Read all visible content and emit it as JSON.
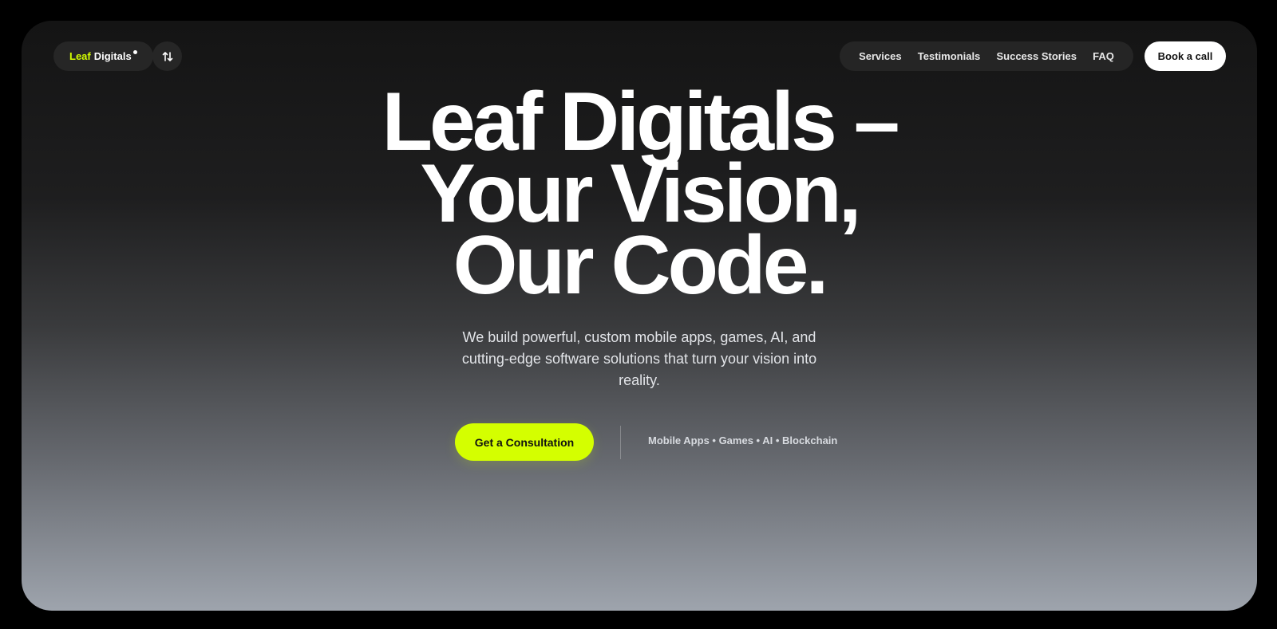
{
  "brand": {
    "leaf": "Leaf",
    "digitals": "Digitals"
  },
  "icons": {
    "swap": "swap-vertical-icon",
    "registered": "registered-dot-icon"
  },
  "nav": {
    "items": [
      {
        "label": "Services"
      },
      {
        "label": "Testimonials"
      },
      {
        "label": "Success Stories"
      },
      {
        "label": "FAQ"
      }
    ],
    "cta_label": "Book a call"
  },
  "hero": {
    "line1": "Leaf Digitals –",
    "line2": "Your Vision,",
    "line3": "Our Code.",
    "subtext": "We build powerful, custom mobile apps, games, AI, and cutting-edge software solutions that turn your vision into reality.",
    "cta_label": "Get a Consultation",
    "tags": "Mobile Apps • Games • AI • Blockchain"
  },
  "colors": {
    "accent": "#d4ff00",
    "background_top": "#141414",
    "background_bottom": "#9ea4ad",
    "pill": "#262626"
  }
}
